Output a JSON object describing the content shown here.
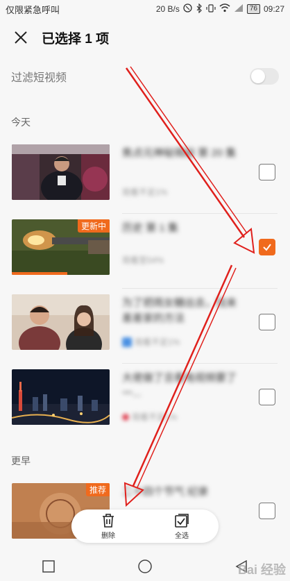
{
  "status_bar": {
    "carrier": "仅限紧急呼叫",
    "speed": "20 B/s",
    "battery": "76",
    "time": "09:27"
  },
  "header": {
    "close_icon": "close-icon",
    "title": "已选择 1 项"
  },
  "filter": {
    "label": "过滤短视频",
    "enabled": false
  },
  "sections": {
    "today": "今天",
    "earlier": "更早"
  },
  "items": [
    {
      "title": "焦点元神秘揭秘 第 20 集",
      "meta": "观看不足1%",
      "badge": "",
      "checked": false
    },
    {
      "title": "历史 第 1 集",
      "meta": "观看至54%",
      "badge": "更新中",
      "checked": true
    },
    {
      "title": "为了把雨女糖出去，找来差差家的方法",
      "meta": "观看不足1%",
      "badge": "",
      "checked": false
    },
    {
      "title": "大佬做了旦看电视频要了一...",
      "meta": "观看不足1%",
      "badge": "",
      "checked": false
    },
    {
      "title": "二十四个节气 纪录",
      "meta": "观看至1%",
      "badge": "推荐",
      "checked": false
    }
  ],
  "actions": {
    "delete_label": "删除",
    "select_all_label": "全选"
  },
  "colors": {
    "accent": "#f06a1d",
    "annotation": "#e0201c"
  }
}
